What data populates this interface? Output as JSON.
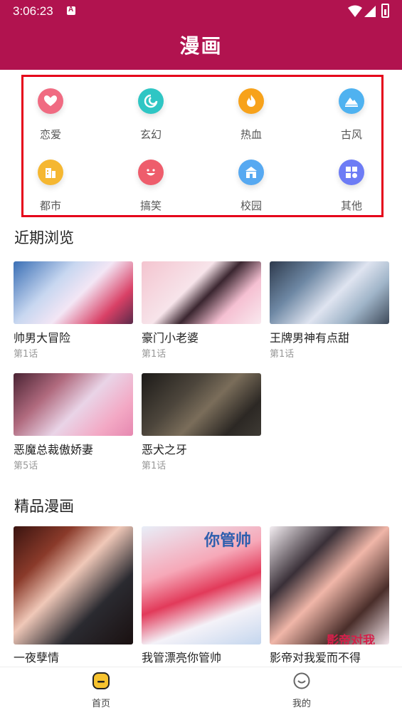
{
  "status": {
    "time": "3:06:23"
  },
  "header": {
    "title": "漫画"
  },
  "categories": [
    {
      "label": "恋爱",
      "icon": "heart-icon",
      "color": "#f06b82"
    },
    {
      "label": "玄幻",
      "icon": "swirl-icon",
      "color": "#2fc6c4"
    },
    {
      "label": "热血",
      "icon": "flame-icon",
      "color": "#f7a21b"
    },
    {
      "label": "古风",
      "icon": "mountain-icon",
      "color": "#4fb2f0"
    },
    {
      "label": "都市",
      "icon": "building-icon",
      "color": "#f5b731"
    },
    {
      "label": "搞笑",
      "icon": "smile-icon",
      "color": "#ee5d6c"
    },
    {
      "label": "校园",
      "icon": "school-icon",
      "color": "#57a9f1"
    },
    {
      "label": "其他",
      "icon": "grid-icon",
      "color": "#6d7cf5"
    }
  ],
  "recent": {
    "title": "近期浏览",
    "items": [
      {
        "name": "帅男大冒险",
        "episode": "第1话"
      },
      {
        "name": "豪门小老婆",
        "episode": "第1话"
      },
      {
        "name": "王牌男神有点甜",
        "episode": "第1话"
      },
      {
        "name": "恶魔总裁傲娇妻",
        "episode": "第5话"
      },
      {
        "name": "恶犬之牙",
        "episode": "第1话"
      }
    ]
  },
  "featured": {
    "title": "精品漫画",
    "items": [
      {
        "name": "一夜孽情",
        "cover_text": ""
      },
      {
        "name": "我管漂亮你管帅",
        "cover_text": "你管帅"
      },
      {
        "name": "影帝对我爱而不得",
        "cover_text": "影帝对我"
      }
    ]
  },
  "nav": {
    "home": "首页",
    "mine": "我的"
  },
  "colors": {
    "brand": "#b1134f",
    "highlight_border": "#e5001a"
  }
}
